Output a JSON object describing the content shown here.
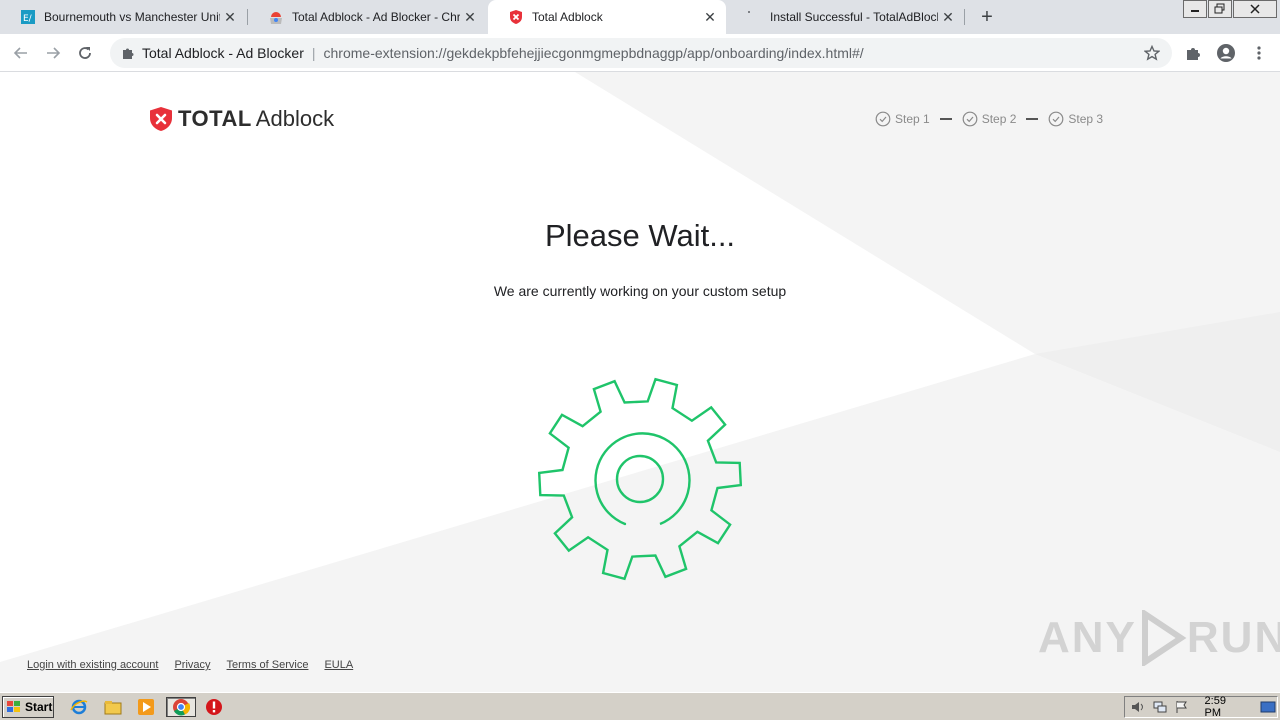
{
  "browser": {
    "tabs": [
      {
        "title": "Bournemouth vs Manchester United",
        "active": false
      },
      {
        "title": "Total Adblock - Ad Blocker - Chrome",
        "active": false
      },
      {
        "title": "Total Adblock",
        "active": true
      },
      {
        "title": "Install Successful - TotalAdBlock",
        "active": false
      }
    ],
    "close_glyph": "✕",
    "new_tab_glyph": "+",
    "omnibox": {
      "site_name": "Total Adblock - Ad Blocker",
      "divider": "|",
      "url": "chrome-extension://gekdekpbfehejjiecgonmgmepbdnaggp/app/onboarding/index.html#/"
    }
  },
  "page": {
    "logo": {
      "bold": "TOTAL",
      "regular": "Adblock"
    },
    "steps": [
      {
        "label": "Step 1"
      },
      {
        "label": "Step 2"
      },
      {
        "label": "Step 3"
      }
    ],
    "heading": "Please Wait...",
    "subtext": "We are currently working on your custom setup",
    "footer": {
      "login": "Login with existing account",
      "privacy": "Privacy",
      "terms": "Terms of Service",
      "eula": "EULA"
    },
    "watermark": {
      "left": "ANY",
      "right": "RUN"
    }
  },
  "taskbar": {
    "start_label": "Start",
    "clock": "2:59 PM"
  },
  "colors": {
    "accent_green": "#1fc46a",
    "logo_red": "#e8313a",
    "tab_strip": "#dee1e6"
  }
}
